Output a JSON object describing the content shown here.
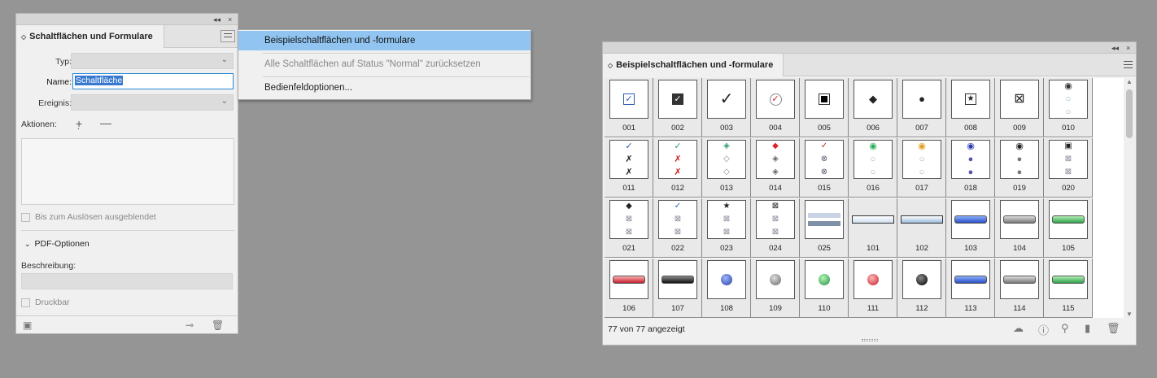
{
  "left_panel": {
    "title": "Schaltflächen und Formulare",
    "collapse_glyph": "◂◂",
    "close_glyph": "×",
    "typ_label": "Typ:",
    "name_label": "Name:",
    "name_value": "Schaltfläche",
    "ereignis_label": "Ereignis:",
    "aktionen_label": "Aktionen:",
    "hidden_label": "Bis zum Auslösen ausgeblendet",
    "pdf_label": "PDF-Optionen",
    "beschreibung_label": "Beschreibung:",
    "druckbar_label": "Druckbar"
  },
  "flyout_menu": {
    "items": [
      {
        "label": "Beispielschaltflächen und -formulare"
      },
      {
        "label": "Alle Schaltflächen auf Status \"Normal\" zurücksetzen"
      },
      {
        "label": "Bedienfeldoptionen..."
      }
    ]
  },
  "right_panel": {
    "title": "Beispielschaltflächen und -formulare",
    "status": "77 von 77 angezeigt",
    "cells": [
      {
        "num": "001",
        "icon": "checkbox-checked-icon"
      },
      {
        "num": "002",
        "icon": "checkbox-checked-dark-icon"
      },
      {
        "num": "003",
        "icon": "checkmark-icon"
      },
      {
        "num": "004",
        "icon": "check-circle-icon"
      },
      {
        "num": "005",
        "icon": "square-filled-icon"
      },
      {
        "num": "006",
        "icon": "diamond-icon"
      },
      {
        "num": "007",
        "icon": "dot-icon"
      },
      {
        "num": "008",
        "icon": "star-icon"
      },
      {
        "num": "009",
        "icon": "cross-box-icon"
      },
      {
        "num": "010",
        "icon": "radio-group-icon"
      },
      {
        "num": "011",
        "icon": "check-x-list-icon"
      },
      {
        "num": "012",
        "icon": "check-x-color-list-icon"
      },
      {
        "num": "013",
        "icon": "diamond-list-icon"
      },
      {
        "num": "014",
        "icon": "diamond-red-list-icon"
      },
      {
        "num": "015",
        "icon": "check-circle-list-icon"
      },
      {
        "num": "016",
        "icon": "green-radio-list-icon"
      },
      {
        "num": "017",
        "icon": "orange-radio-list-icon"
      },
      {
        "num": "018",
        "icon": "blue-radio-list-icon"
      },
      {
        "num": "019",
        "icon": "gray-radio-list-icon"
      },
      {
        "num": "020",
        "icon": "square-cross-list-icon"
      },
      {
        "num": "021",
        "icon": "diamond-cross-list-icon"
      },
      {
        "num": "022",
        "icon": "check-cross-list-icon"
      },
      {
        "num": "023",
        "icon": "star-cross-list-icon"
      },
      {
        "num": "024",
        "icon": "cross-list-icon"
      },
      {
        "num": "025",
        "icon": "form-fields-icon"
      },
      {
        "num": "101",
        "icon": "text-field-icon"
      },
      {
        "num": "102",
        "icon": "text-field-blue-icon"
      },
      {
        "num": "103",
        "icon": "blue-bar-button-icon"
      },
      {
        "num": "104",
        "icon": "gray-bar-button-icon"
      },
      {
        "num": "105",
        "icon": "green-bar-button-icon"
      },
      {
        "num": "106",
        "icon": "red-bar-button-icon"
      },
      {
        "num": "107",
        "icon": "black-bar-button-icon"
      },
      {
        "num": "108",
        "icon": "blue-round-button-icon"
      },
      {
        "num": "109",
        "icon": "gray-round-button-icon"
      },
      {
        "num": "110",
        "icon": "green-round-button-icon"
      },
      {
        "num": "111",
        "icon": "red-round-button-icon"
      },
      {
        "num": "112",
        "icon": "black-round-button-icon"
      },
      {
        "num": "113",
        "icon": "blue-bar-button-icon"
      },
      {
        "num": "114",
        "icon": "gray-bar-button-icon"
      },
      {
        "num": "115",
        "icon": "green-bar-button-icon"
      }
    ]
  },
  "colors": {
    "background": "#959595",
    "panel": "#f0f0f0",
    "menu_highlight": "#91c4f0",
    "selection": "#3778d0"
  }
}
